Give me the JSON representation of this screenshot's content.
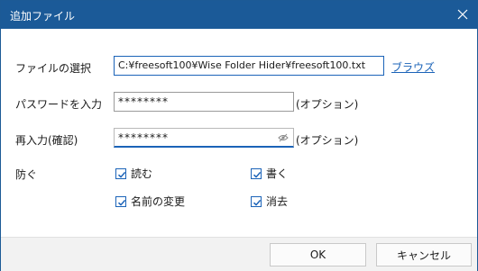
{
  "window": {
    "title": "追加ファイル"
  },
  "form": {
    "file_label": "ファイルの選択",
    "file_path": "C:¥freesoft100¥Wise Folder Hider¥freesoft100.txt",
    "browse_label": "ブラウズ",
    "password_label": "パスワードを入力",
    "password_value": "********",
    "password_optional": "(オプション)",
    "confirm_label": "再入力(確認)",
    "confirm_value": "********",
    "confirm_optional": "(オプション)",
    "protect_label": "防ぐ"
  },
  "options": {
    "read": {
      "label": "読む",
      "checked": true
    },
    "write": {
      "label": "書く",
      "checked": true
    },
    "rename": {
      "label": "名前の変更",
      "checked": true
    },
    "delete": {
      "label": "消去",
      "checked": true
    }
  },
  "buttons": {
    "ok": "OK",
    "cancel": "キャンセル"
  },
  "colors": {
    "title_bar": "#1b5a98",
    "accent": "#1b63b8",
    "footer": "#f2f2f2"
  },
  "icons": {
    "close": "close-icon",
    "eye": "eye-slash-icon",
    "check": "check-icon"
  }
}
